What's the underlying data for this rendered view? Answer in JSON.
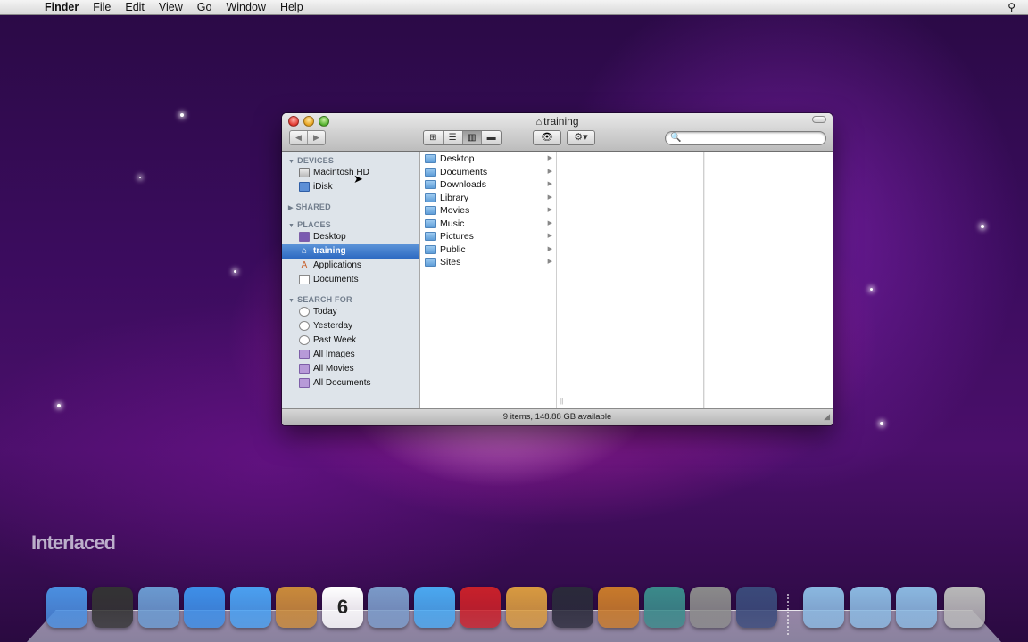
{
  "menubar": {
    "apple": "",
    "items": [
      "Finder",
      "File",
      "Edit",
      "View",
      "Go",
      "Window",
      "Help"
    ],
    "spotlight": "⚲"
  },
  "window": {
    "title": "training",
    "nav": {
      "back": "◀",
      "forward": "▶"
    },
    "view_modes": [
      "⊞",
      "☰",
      "▥",
      "▬"
    ],
    "quicklook": "👁",
    "action": "⚙▾",
    "search": {
      "value": "",
      "placeholder": ""
    }
  },
  "sidebar": {
    "devices_header": "DEVICES",
    "devices": [
      "Macintosh HD",
      "iDisk"
    ],
    "shared_header": "SHARED",
    "places_header": "PLACES",
    "places": [
      "Desktop",
      "training",
      "Applications",
      "Documents"
    ],
    "search_header": "SEARCH FOR",
    "search_for": [
      "Today",
      "Yesterday",
      "Past Week",
      "All Images",
      "All Movies",
      "All Documents"
    ]
  },
  "column1": [
    "Desktop",
    "Documents",
    "Downloads",
    "Library",
    "Movies",
    "Music",
    "Pictures",
    "Public",
    "Sites"
  ],
  "status": "9 items, 148.88 GB available",
  "watermark": "Interlaced",
  "dock": [
    {
      "name": "finder-icon",
      "color": "#4a8fe0"
    },
    {
      "name": "dashboard-icon",
      "color": "#333333"
    },
    {
      "name": "mail-icon",
      "color": "#6a9ad0"
    },
    {
      "name": "safari-icon",
      "color": "#3d8fe8"
    },
    {
      "name": "ichat-icon",
      "color": "#4aa0f0"
    },
    {
      "name": "address-book-icon",
      "color": "#c98a3a"
    },
    {
      "name": "ical-icon",
      "color": "#ffffff",
      "text": "6"
    },
    {
      "name": "iphoto-preview-icon",
      "color": "#7a9ac8"
    },
    {
      "name": "itunes-icon",
      "color": "#4aa8f0"
    },
    {
      "name": "front-row-icon",
      "color": "#c8202a"
    },
    {
      "name": "iphoto-icon",
      "color": "#d89a40"
    },
    {
      "name": "imovie-icon",
      "color": "#2a2a3a"
    },
    {
      "name": "garageband-icon",
      "color": "#c87a2a"
    },
    {
      "name": "time-machine-icon",
      "color": "#3a8a8a"
    },
    {
      "name": "system-preferences-icon",
      "color": "#8a8a8a"
    },
    {
      "name": "spaces-icon",
      "color": "#3a4a7a"
    },
    {
      "name": "applications-stack-icon",
      "color": "#8ab8e0"
    },
    {
      "name": "documents-stack-icon",
      "color": "#8ab8e0"
    },
    {
      "name": "downloads-stack-icon",
      "color": "#8ab8e0"
    },
    {
      "name": "trash-icon",
      "color": "#b8b8b8"
    }
  ]
}
